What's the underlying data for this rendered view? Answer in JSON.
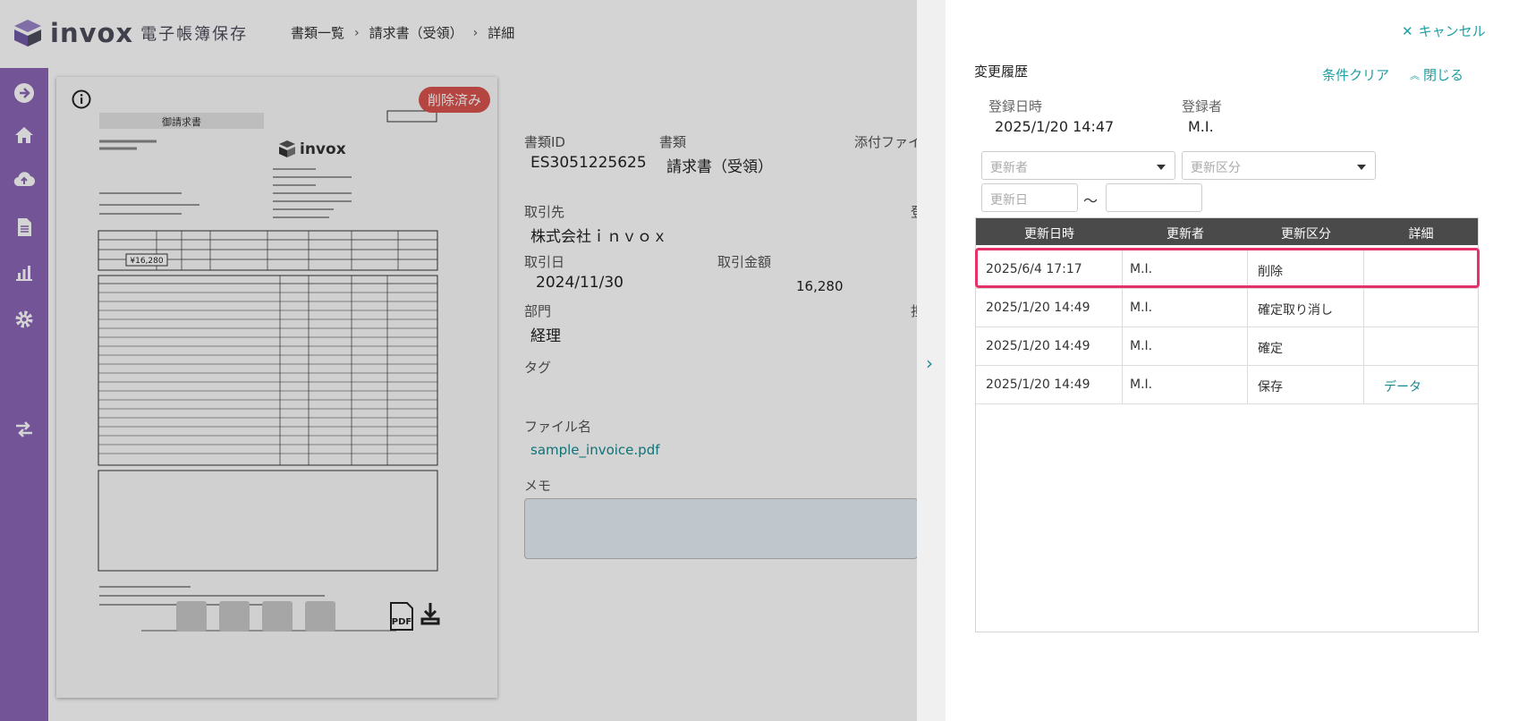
{
  "header": {
    "logo_word": "invox",
    "logo_sub": "電子帳簿保存",
    "breadcrumb": [
      "書類一覧",
      "請求書（受領）",
      "詳細"
    ]
  },
  "sidebar": {
    "items": [
      "arrow-right-circle-icon",
      "home-icon",
      "cloud-upload-icon",
      "document-icon",
      "chart-icon",
      "gear-icon",
      "transfer-icon"
    ]
  },
  "document": {
    "deleted_badge": "削除済み",
    "fields": {
      "doc_id_label": "書類ID",
      "doc_id": "ES3051225625",
      "doc_type_label": "書類",
      "doc_type": "請求書（受領）",
      "attachment_label": "添付ファイ",
      "partner_label": "取引先",
      "partner": "株式会社ｉｎｖｏｘ",
      "date_label": "取引日",
      "date": "2024/11/30",
      "amount_label": "取引金額",
      "amount": "16,280",
      "dept_label": "部門",
      "dept": "経理",
      "tag_label": "タグ",
      "filename_label": "ファイル名",
      "filename": "sample_invoice.pdf",
      "memo_label": "メモ",
      "truncated_1": "登",
      "truncated_2": "担"
    },
    "invoice": {
      "title": "御請求書",
      "total": "¥16,280",
      "logo": "invox",
      "pdf_label": "PDF"
    }
  },
  "panel": {
    "cancel_label": "キャンセル",
    "title": "変更履歴",
    "clear_label": "条件クリア",
    "close_label": "閉じる",
    "registered_at_label": "登録日時",
    "registered_at": "2025/1/20 14:47",
    "registrant_label": "登録者",
    "registrant": "M.I.",
    "filters": {
      "updater_placeholder": "更新者",
      "category_placeholder": "更新区分",
      "date_from_placeholder": "更新日",
      "tilde": "〜"
    },
    "table": {
      "headers": [
        "更新日時",
        "更新者",
        "更新区分",
        "詳細"
      ],
      "rows": [
        {
          "datetime": "2025/6/4 17:17",
          "user": "M.I.",
          "category": "削除",
          "detail": ""
        },
        {
          "datetime": "2025/1/20 14:49",
          "user": "M.I.",
          "category": "確定取り消し",
          "detail": ""
        },
        {
          "datetime": "2025/1/20 14:49",
          "user": "M.I.",
          "category": "確定",
          "detail": ""
        },
        {
          "datetime": "2025/1/20 14:49",
          "user": "M.I.",
          "category": "保存",
          "detail": "データ"
        }
      ]
    }
  },
  "colors": {
    "sidebar": "#8a66b6",
    "accent": "#1f9fa3",
    "highlight": "#e5336a",
    "deleted": "#d9534f",
    "table_header": "#4a4a4a"
  }
}
